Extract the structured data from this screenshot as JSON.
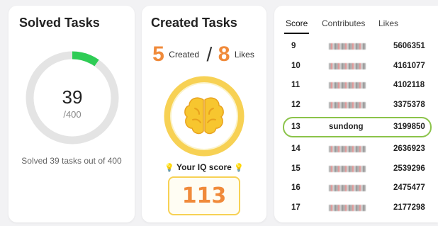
{
  "solved": {
    "title": "Solved Tasks",
    "count": "39",
    "total": "/400",
    "caption": "Solved 39 tasks out of 400",
    "progress_fraction": 0.0975,
    "ring_track_color": "#e4e4e4",
    "ring_fill_color": "#2ecc55"
  },
  "created": {
    "title": "Created Tasks",
    "created_count": "5",
    "created_label": "Created",
    "separator": "/",
    "likes_count": "8",
    "likes_label": "Likes",
    "brain_icon": "brain-icon",
    "iq_label": "Your IQ score",
    "iq_value": "113",
    "accent_color": "#f08a3a",
    "ring_color": "#f7d154"
  },
  "leaderboard": {
    "tabs": [
      {
        "label": "Score",
        "active": true
      },
      {
        "label": "Contributes",
        "active": false
      },
      {
        "label": "Likes",
        "active": false
      }
    ],
    "rows": [
      {
        "rank": "9",
        "name": "",
        "score": "5606351",
        "blurred": true
      },
      {
        "rank": "10",
        "name": "",
        "score": "4161077",
        "blurred": true
      },
      {
        "rank": "11",
        "name": "",
        "score": "4102118",
        "blurred": true
      },
      {
        "rank": "12",
        "name": "",
        "score": "3375378",
        "blurred": true
      },
      {
        "rank": "13",
        "name": "sundong",
        "score": "3199850",
        "blurred": false,
        "highlight": true
      },
      {
        "rank": "14",
        "name": "",
        "score": "2636923",
        "blurred": true
      },
      {
        "rank": "15",
        "name": "",
        "score": "2539296",
        "blurred": true
      },
      {
        "rank": "16",
        "name": "",
        "score": "2475477",
        "blurred": true
      },
      {
        "rank": "17",
        "name": "",
        "score": "2177298",
        "blurred": true
      }
    ],
    "highlight_color": "#8bc34a"
  }
}
